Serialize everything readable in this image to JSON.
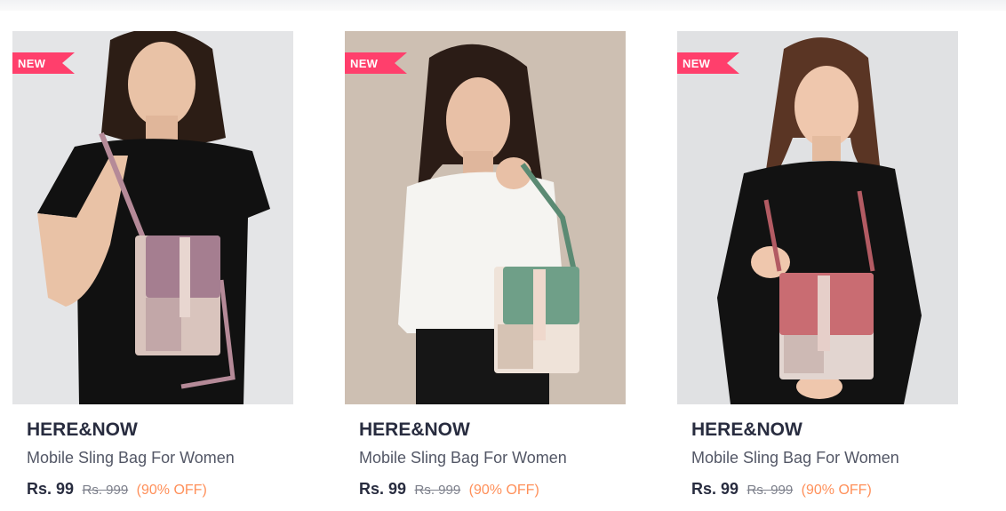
{
  "products": [
    {
      "badge": "NEW",
      "brand": "HERE&NOW",
      "name": "Mobile Sling Bag For Women",
      "price": "Rs. 99",
      "mrp": "Rs. 999",
      "discount": "(90% OFF)",
      "colors": {
        "backdrop": "#e4e5e7",
        "top": "#111111",
        "hair": "#2c1d15",
        "skin": "#e9c2a6",
        "bag_flap": "#a57e90",
        "bag_body": "#d9c4bd",
        "strap": "#b58a98"
      }
    },
    {
      "badge": "NEW",
      "brand": "HERE&NOW",
      "name": "Mobile Sling Bag For Women",
      "price": "Rs. 99",
      "mrp": "Rs. 999",
      "discount": "(90% OFF)",
      "colors": {
        "backdrop": "#cdbfb2",
        "top": "#f5f4f1",
        "hair": "#2b1c16",
        "skin": "#e8c0a6",
        "bag_flap": "#6f9f88",
        "bag_body": "#efe3d9",
        "strap": "#5b8a73"
      }
    },
    {
      "badge": "NEW",
      "brand": "HERE&NOW",
      "name": "Mobile Sling Bag For Women",
      "price": "Rs. 99",
      "mrp": "Rs. 999",
      "discount": "(90% OFF)",
      "colors": {
        "backdrop": "#e0e1e3",
        "top": "#121212",
        "hair": "#5a3524",
        "skin": "#efc7ad",
        "bag_flap": "#c96c72",
        "bag_body": "#e2d5d0",
        "strap": "#b35b63"
      }
    }
  ],
  "theme": {
    "badge_pink": "#ff3f6c",
    "brand_text": "#282c3f",
    "name_text": "#535766",
    "mrp_text": "#7e818c",
    "discount_text": "#ff905a"
  }
}
